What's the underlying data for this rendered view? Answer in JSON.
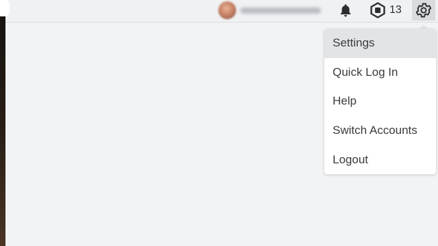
{
  "topbar": {
    "robux_count": "13"
  },
  "settings_menu": {
    "items": [
      {
        "label": "Settings"
      },
      {
        "label": "Quick Log In"
      },
      {
        "label": "Help"
      },
      {
        "label": "Switch Accounts"
      },
      {
        "label": "Logout"
      }
    ]
  },
  "icons": {
    "bell": "bell-icon",
    "robux": "robux-icon",
    "settings": "gear-icon"
  },
  "colors": {
    "page_background": "#f2f3f5",
    "menu_active_background": "#e3e4e6",
    "menu_text": "#393b3d"
  }
}
